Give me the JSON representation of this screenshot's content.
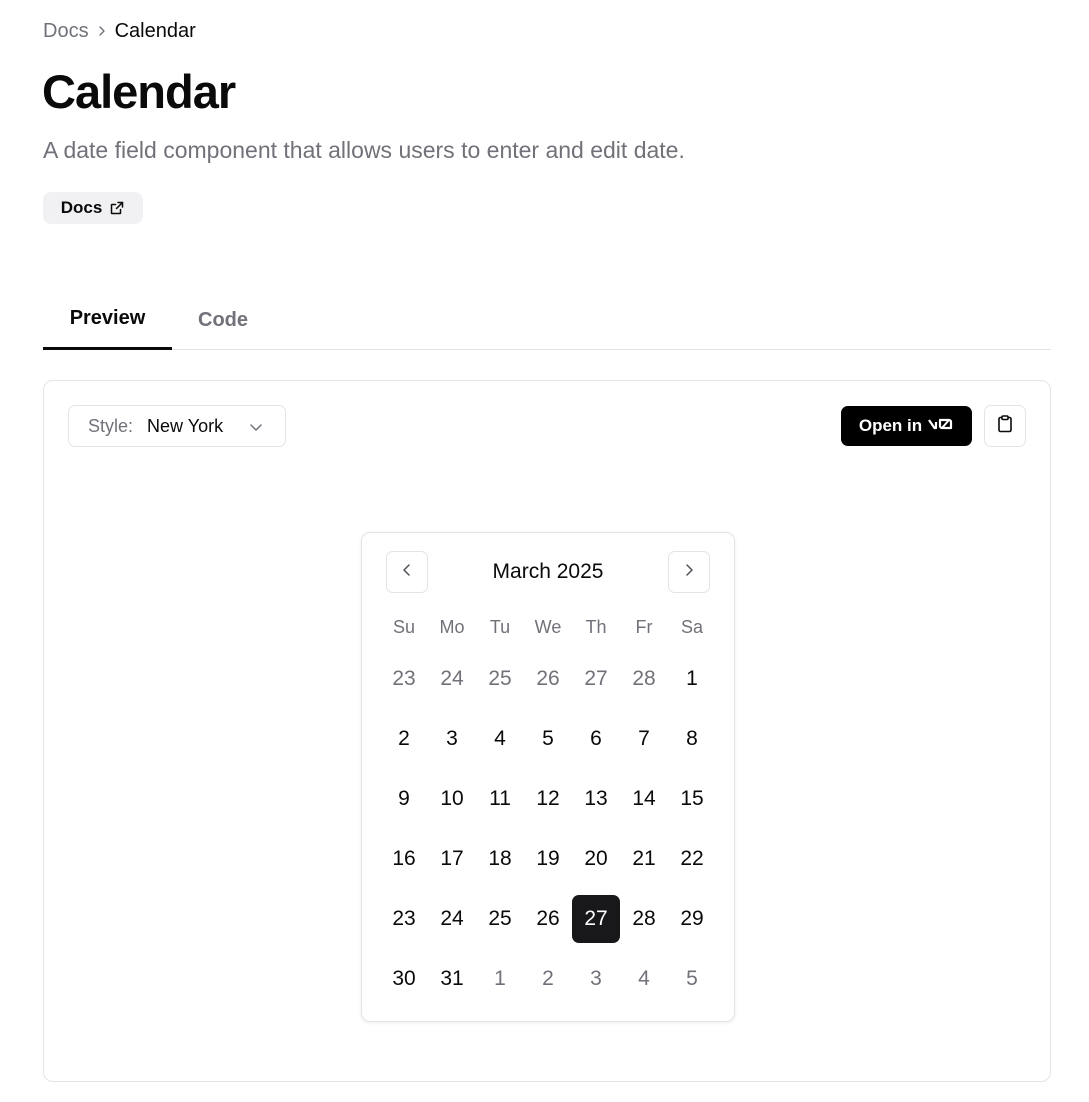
{
  "breadcrumb": {
    "parent": "Docs",
    "current": "Calendar"
  },
  "page": {
    "title": "Calendar",
    "description": "A date field component that allows users to enter and edit date.",
    "docs_badge": "Docs"
  },
  "tabs": [
    {
      "label": "Preview",
      "active": true
    },
    {
      "label": "Code",
      "active": false
    }
  ],
  "toolbar": {
    "style_label": "Style:",
    "style_value": "New York",
    "open_in_label": "Open in",
    "open_in_logo": "v0"
  },
  "calendar": {
    "month_title": "March 2025",
    "weekdays": [
      "Su",
      "Mo",
      "Tu",
      "We",
      "Th",
      "Fr",
      "Sa"
    ],
    "weeks": [
      [
        {
          "d": "23",
          "o": true
        },
        {
          "d": "24",
          "o": true
        },
        {
          "d": "25",
          "o": true
        },
        {
          "d": "26",
          "o": true
        },
        {
          "d": "27",
          "o": true
        },
        {
          "d": "28",
          "o": true
        },
        {
          "d": "1",
          "o": false
        }
      ],
      [
        {
          "d": "2",
          "o": false
        },
        {
          "d": "3",
          "o": false
        },
        {
          "d": "4",
          "o": false
        },
        {
          "d": "5",
          "o": false
        },
        {
          "d": "6",
          "o": false
        },
        {
          "d": "7",
          "o": false
        },
        {
          "d": "8",
          "o": false
        }
      ],
      [
        {
          "d": "9",
          "o": false
        },
        {
          "d": "10",
          "o": false
        },
        {
          "d": "11",
          "o": false
        },
        {
          "d": "12",
          "o": false
        },
        {
          "d": "13",
          "o": false
        },
        {
          "d": "14",
          "o": false
        },
        {
          "d": "15",
          "o": false
        }
      ],
      [
        {
          "d": "16",
          "o": false
        },
        {
          "d": "17",
          "o": false
        },
        {
          "d": "18",
          "o": false
        },
        {
          "d": "19",
          "o": false
        },
        {
          "d": "20",
          "o": false
        },
        {
          "d": "21",
          "o": false
        },
        {
          "d": "22",
          "o": false
        }
      ],
      [
        {
          "d": "23",
          "o": false
        },
        {
          "d": "24",
          "o": false
        },
        {
          "d": "25",
          "o": false
        },
        {
          "d": "26",
          "o": false
        },
        {
          "d": "27",
          "o": false,
          "selected": true
        },
        {
          "d": "28",
          "o": false
        },
        {
          "d": "29",
          "o": false
        }
      ],
      [
        {
          "d": "30",
          "o": false
        },
        {
          "d": "31",
          "o": false
        },
        {
          "d": "1",
          "o": true
        },
        {
          "d": "2",
          "o": true
        },
        {
          "d": "3",
          "o": true
        },
        {
          "d": "4",
          "o": true
        },
        {
          "d": "5",
          "o": true
        }
      ]
    ],
    "selected_date": "27"
  },
  "colors": {
    "text": "#0a0a0a",
    "muted": "#71717a",
    "border": "#e4e4e7",
    "selected_bg": "#18181b",
    "badge_bg": "#f1f1f3"
  },
  "icons": [
    "chevron-right-icon",
    "external-link-icon",
    "chevron-down-icon",
    "v0-logo-icon",
    "clipboard-icon",
    "chevron-left-icon"
  ]
}
